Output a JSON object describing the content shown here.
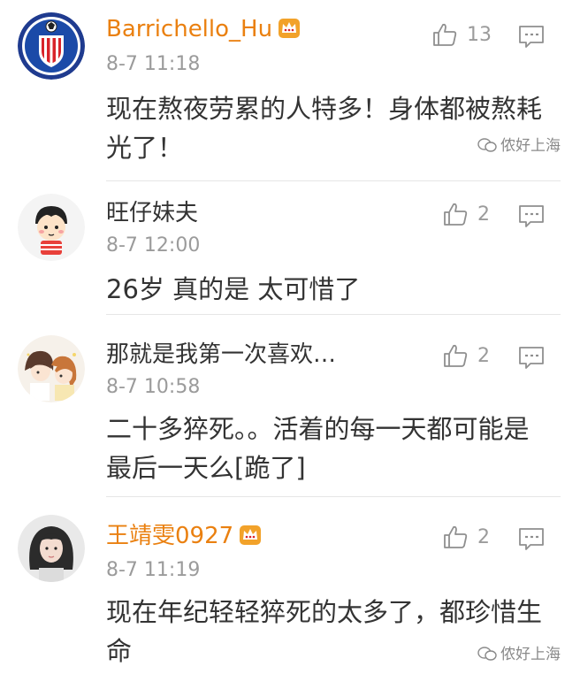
{
  "comments": [
    {
      "name": "Barrichello_Hu",
      "vip": true,
      "time": "8-7 11:18",
      "text": "现在熬夜劳累的人特多！身体都被熬耗光了！",
      "likes": "13",
      "avatar": "shanghai-sipg-fc-logo"
    },
    {
      "name": "旺仔妹夫",
      "vip": false,
      "time": "8-7 12:00",
      "text": "26岁 真的是 太可惜了",
      "likes": "2",
      "avatar": "cartoon-boy"
    },
    {
      "name": "那就是我第一次喜欢…",
      "vip": false,
      "time": "8-7 10:58",
      "text": "二十多猝死。。活着的每一天都可能是最后一天么[跪了]",
      "likes": "2",
      "avatar": "anime-couple"
    },
    {
      "name": "王靖雯0927",
      "vip": true,
      "time": "8-7 11:19",
      "text": "现在年纪轻轻猝死的太多了，都珍惜生命",
      "likes": "2",
      "avatar": "girl-photo"
    }
  ],
  "watermark": "侬好上海",
  "colors": {
    "vip_name": "#ea8010",
    "normal_name": "#333333",
    "meta": "#9b9b9b",
    "divider": "#e6e6e6"
  },
  "icons": {
    "like": "thumbs-up-icon",
    "reply": "comment-bubble-icon",
    "vip": "crown-icon",
    "watermark": "wechat-icon"
  }
}
